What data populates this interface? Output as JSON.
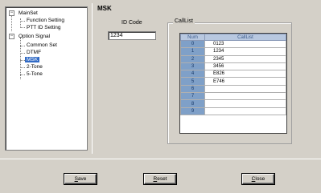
{
  "tree": {
    "items": [
      {
        "label": "MainSet"
      },
      {
        "label": "Function Setting"
      },
      {
        "label": "PTT ID Setting"
      },
      {
        "label": "Option Signal"
      },
      {
        "label": "Common Set"
      },
      {
        "label": "DTMF"
      },
      {
        "label": "MSK"
      },
      {
        "label": "2-Tone"
      },
      {
        "label": "5-Tone"
      }
    ],
    "selected": "MSK",
    "expander_minus": "−"
  },
  "main": {
    "section_title": "MSK",
    "id_code_label": "ID Code",
    "id_code_value": "1234",
    "calllist_group_title": "CallList",
    "grid": {
      "headers": [
        "Num",
        "CallList"
      ],
      "rows": [
        {
          "num": "0",
          "call": "0123"
        },
        {
          "num": "1",
          "call": "1234"
        },
        {
          "num": "2",
          "call": "2345"
        },
        {
          "num": "3",
          "call": "3456"
        },
        {
          "num": "4",
          "call": "E826"
        },
        {
          "num": "5",
          "call": "E746"
        },
        {
          "num": "6",
          "call": ""
        },
        {
          "num": "7",
          "call": ""
        },
        {
          "num": "8",
          "call": ""
        },
        {
          "num": "9",
          "call": ""
        }
      ]
    }
  },
  "buttons": {
    "save": {
      "first": "S",
      "rest": "ave"
    },
    "reset": {
      "first": "R",
      "rest": "eset"
    },
    "close": {
      "first": "C",
      "rest": "lose"
    }
  },
  "colors": {
    "selection": "#316ac5",
    "grid_header": "#b8c8e0",
    "num_column": "#7fa0c8"
  }
}
